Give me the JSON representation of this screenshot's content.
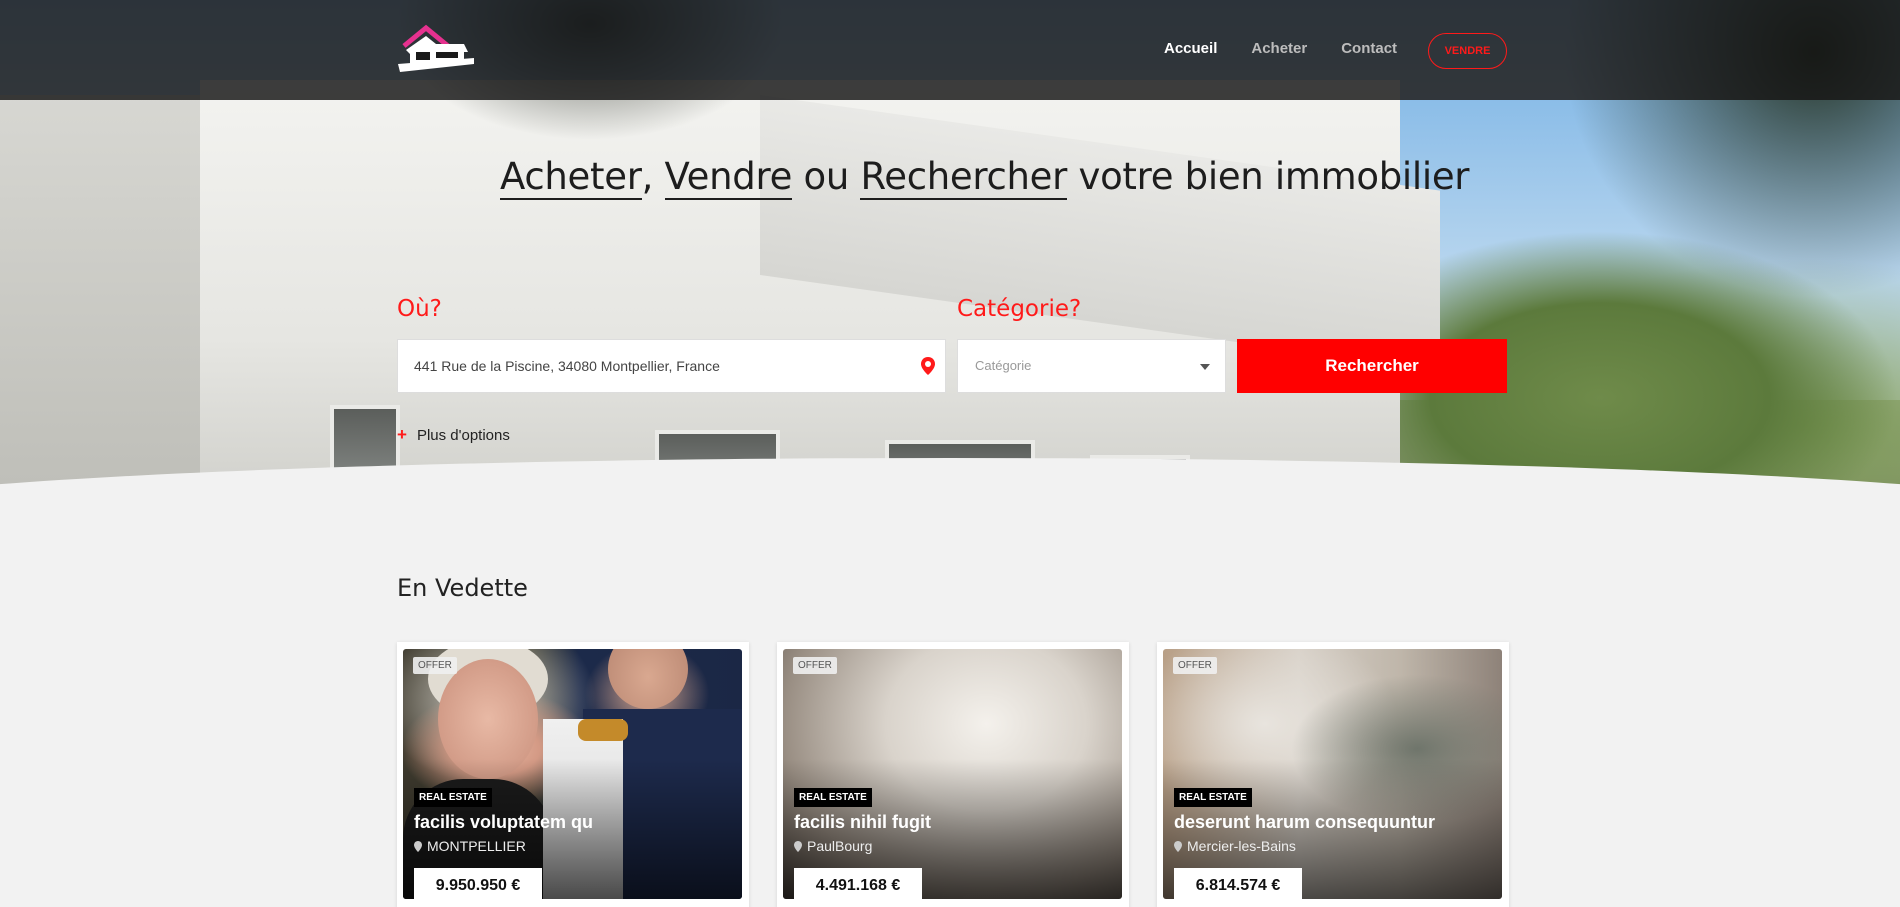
{
  "nav": {
    "links": [
      "Accueil",
      "Acheter",
      "Contact"
    ],
    "sell_label": "VENDRE"
  },
  "hero": {
    "headline": {
      "w1": "Acheter",
      "sep1": ", ",
      "w2": "Vendre",
      "sep2": " ou ",
      "w3": "Rechercher",
      "rest": " votre bien immobilier"
    },
    "where_label": "Où?",
    "category_label": "Catégorie?",
    "address_value": "441 Rue de la Piscine, 34080 Montpellier, France",
    "category_placeholder": "Catégorie",
    "search_button": "Rechercher",
    "more_options": "Plus d'options"
  },
  "featured": {
    "title": "En Vedette",
    "cards": [
      {
        "offer": "OFFER",
        "tag": "REAL ESTATE",
        "title": "facilis voluptatem qu",
        "location": "MONTPELLIER",
        "price": "9.950.950 €"
      },
      {
        "offer": "OFFER",
        "tag": "REAL ESTATE",
        "title": "facilis nihil fugit",
        "location": "PaulBourg",
        "price": "4.491.168 €"
      },
      {
        "offer": "OFFER",
        "tag": "REAL ESTATE",
        "title": "deserunt harum consequuntur",
        "location": "Mercier-les-Bains",
        "price": "6.814.574 €"
      }
    ]
  },
  "colors": {
    "accent": "#ff0000",
    "logo_pink": "#e6318f"
  },
  "icons": [
    "logo-house-icon",
    "map-pin-icon",
    "caret-down-icon",
    "plus-icon",
    "location-pin-icon"
  ]
}
